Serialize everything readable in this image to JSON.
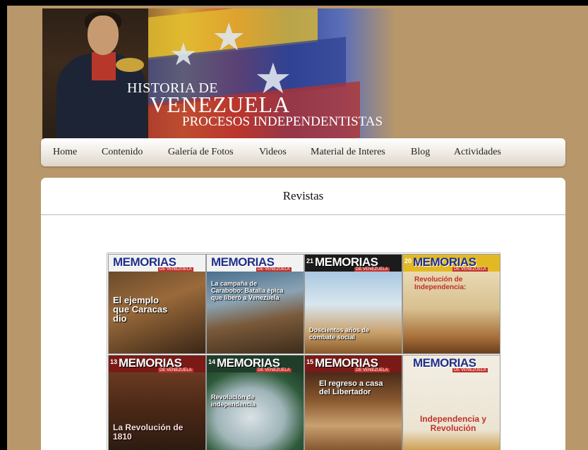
{
  "banner": {
    "title_line1": "HISTORIA DE",
    "title_line2": "VENEZUELA",
    "title_line3": "PROCESOS INDEPENDENTISTAS"
  },
  "nav": {
    "items": [
      {
        "label": "Home"
      },
      {
        "label": "Contenido"
      },
      {
        "label": "Galería de Fotos"
      },
      {
        "label": "Videos"
      },
      {
        "label": "Material de Interes"
      },
      {
        "label": "Blog"
      },
      {
        "label": "Actividades"
      }
    ]
  },
  "main": {
    "heading": "Revistas",
    "covers": [
      {
        "mast": "MEMORIAS",
        "mast_sub": "DE VENEZUELA",
        "number": "",
        "headline": "El ejemplo que Caracas dio"
      },
      {
        "mast": "MEMORIAS",
        "mast_sub": "DE VENEZUELA",
        "number": "",
        "headline": "La campaña de Carabobo: Batalla épica que liberó a Venezuela"
      },
      {
        "mast": "MEMORIAS",
        "mast_sub": "DE VENEZUELA",
        "number": "21",
        "headline": "Doscientos años de combate social"
      },
      {
        "mast": "MEMORIAS",
        "mast_sub": "DE VENEZUELA",
        "number": "20",
        "headline": "Revolución de Independencia:"
      },
      {
        "mast": "MEMORIAS",
        "mast_sub": "DE VENEZUELA",
        "number": "13",
        "headline": "La Revolución de 1810"
      },
      {
        "mast": "MEMORIAS",
        "mast_sub": "DE VENEZUELA",
        "number": "14",
        "headline": "Revolución de independencia"
      },
      {
        "mast": "MEMORIAS",
        "mast_sub": "DE VENEZUELA",
        "number": "15",
        "headline": "El regreso a casa del Libertador"
      },
      {
        "mast": "MEMORIAS",
        "mast_sub": "DE VENEZUELA",
        "number": "",
        "headline": "Independencia y Revolución"
      }
    ]
  }
}
